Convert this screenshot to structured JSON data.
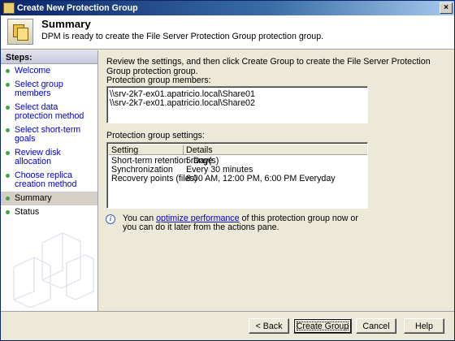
{
  "window": {
    "title": "Create New Protection Group"
  },
  "header": {
    "title": "Summary",
    "subtitle": "DPM is ready to create the File Server Protection Group protection group."
  },
  "sidebar": {
    "title": "Steps:",
    "items": [
      {
        "label": "Welcome"
      },
      {
        "label": "Select group members"
      },
      {
        "label": "Select data protection method"
      },
      {
        "label": "Select short-term goals"
      },
      {
        "label": "Review disk allocation"
      },
      {
        "label": "Choose replica creation method"
      },
      {
        "label": "Summary"
      },
      {
        "label": "Status"
      }
    ]
  },
  "main": {
    "instructions": "Review the settings, and then click Create Group to create the File Server Protection Group protection group.",
    "members_label": "Protection group members:",
    "members": [
      "\\\\srv-2k7-ex01.apatricio.local\\Share01",
      "\\\\srv-2k7-ex01.apatricio.local\\Share02"
    ],
    "settings_label": "Protection group settings:",
    "settings_columns": [
      "Setting",
      "Details"
    ],
    "settings_rows": [
      [
        "Short-term retention range",
        "5 Day(s)"
      ],
      [
        "Synchronization",
        "Every 30 minutes"
      ],
      [
        "Recovery points (files)",
        "8:00 AM, 12:00 PM, 6:00 PM Everyday"
      ]
    ],
    "info": {
      "prefix": "You can ",
      "link": "optimize performance",
      "suffix": " of this protection group now or you can do it later from the actions pane."
    }
  },
  "buttons": {
    "back": "< Back",
    "create": "Create Group",
    "cancel": "Cancel",
    "help": "Help"
  },
  "icons": {
    "close": "close-icon",
    "info": "info-icon",
    "bullet": "green-bullet-icon"
  }
}
